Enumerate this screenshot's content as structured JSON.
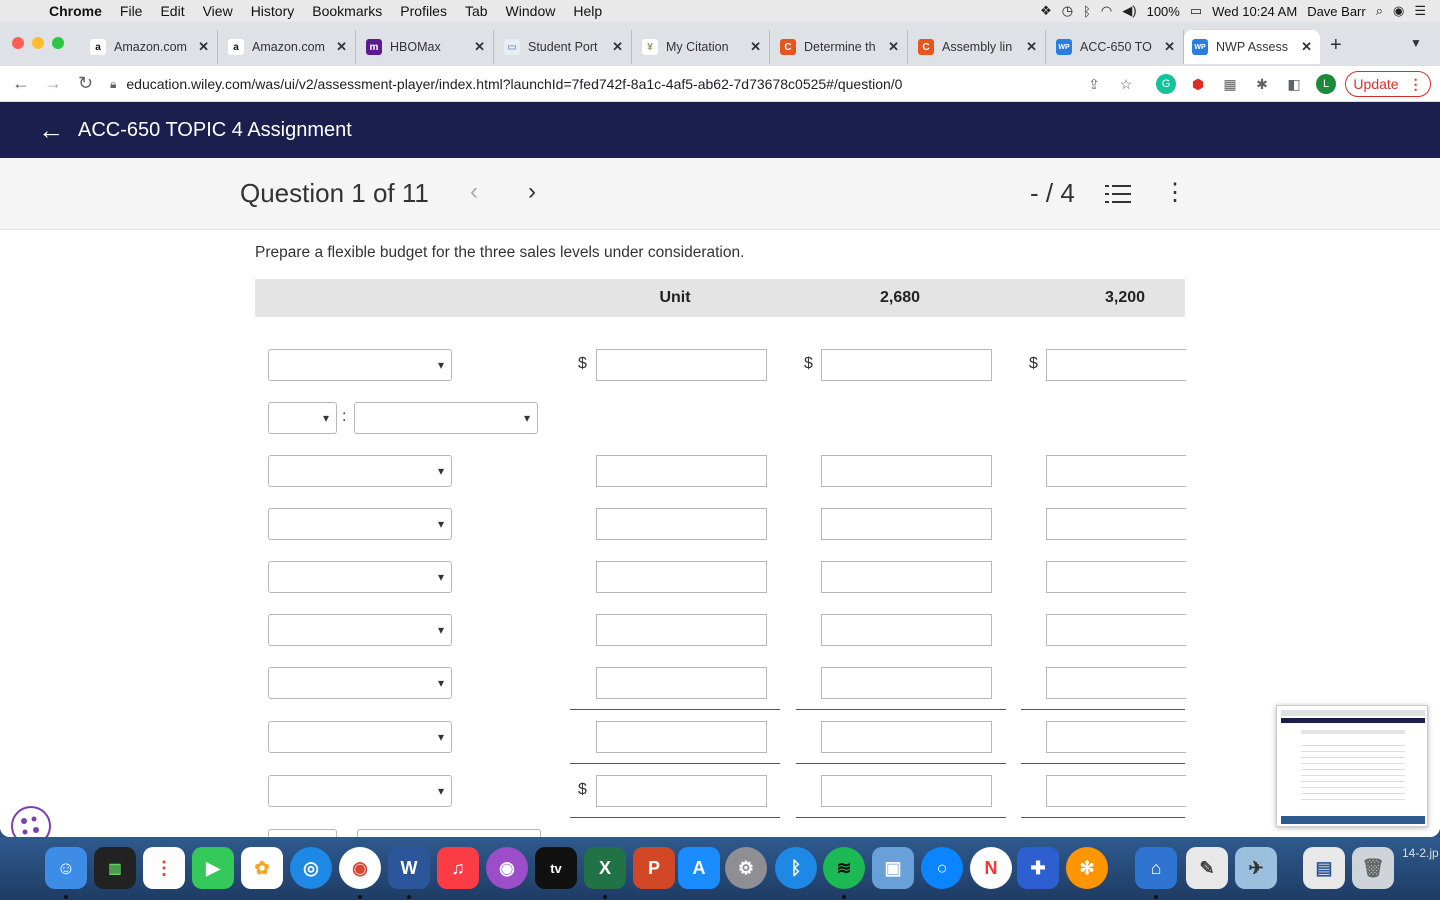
{
  "menubar": {
    "app": "Chrome",
    "items": [
      "File",
      "Edit",
      "View",
      "History",
      "Bookmarks",
      "Profiles",
      "Tab",
      "Window",
      "Help"
    ],
    "battery": "100%",
    "clock": "Wed 10:24 AM",
    "user": "Dave Barr"
  },
  "tabs": [
    {
      "title": "Amazon.com",
      "favicon": "a",
      "color": "#111111"
    },
    {
      "title": "Amazon.com",
      "favicon": "a",
      "color": "#111111"
    },
    {
      "title": "HBOMax",
      "favicon": "m",
      "color": "#5b1a8f"
    },
    {
      "title": "Student Port",
      "favicon": "▭",
      "color": "#8aa0c0"
    },
    {
      "title": "My Citation",
      "favicon": "¥",
      "color": "#8c9a5a"
    },
    {
      "title": "Determine th",
      "favicon": "C",
      "color": "#e8541e"
    },
    {
      "title": "Assembly lin",
      "favicon": "C",
      "color": "#e8541e"
    },
    {
      "title": "ACC-650 TO",
      "favicon": "WP",
      "color": "#2a7de1"
    },
    {
      "title": "NWP Assess",
      "favicon": "WP",
      "color": "#2a7de1"
    }
  ],
  "address": {
    "url": "education.wiley.com/was/ui/v2/assessment-player/index.html?launchId=7fed742f-8a1c-4af5-ab62-7d73678c0525#/question/0",
    "update_label": "Update"
  },
  "app": {
    "title": "ACC-650 TOPIC 4 Assignment"
  },
  "question": {
    "number_label": "Question 1 of 11",
    "score": "- / 4",
    "prompt": "Prepare a flexible budget for the three sales levels under consideration."
  },
  "table": {
    "headers": [
      "",
      "Unit",
      "2,680",
      "3,200"
    ],
    "currency_symbol": "$",
    "colon": ":"
  },
  "dock": {
    "file_label": "14-2.jp"
  },
  "colors": {
    "header_bg": "#1b1f4e",
    "update_red": "#d93025"
  }
}
